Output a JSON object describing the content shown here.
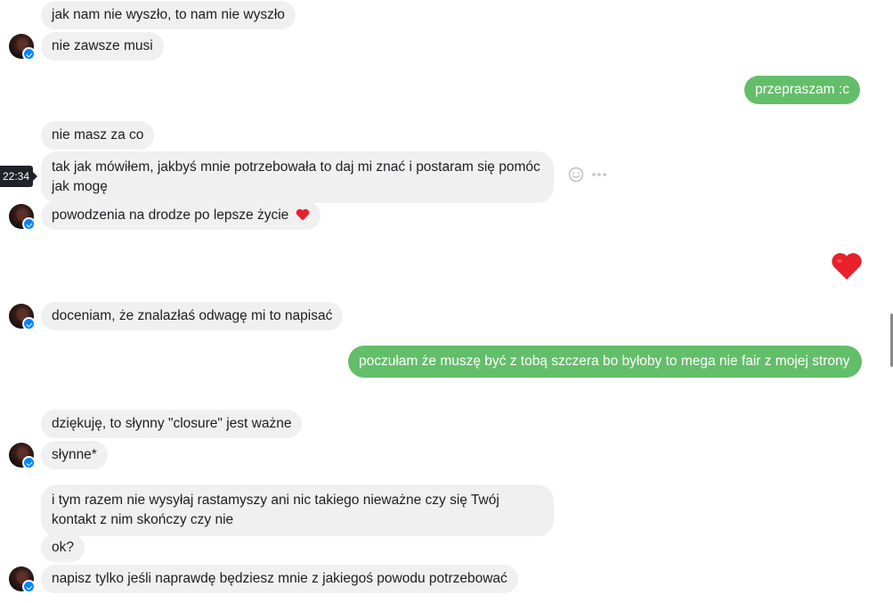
{
  "conversation": {
    "messages": [
      {
        "text": "jak nam nie wyszło, to nam nie wyszło",
        "side": "in"
      },
      {
        "text": "nie zawsze musi",
        "side": "in"
      },
      {
        "text": "przepraszam :c",
        "side": "out"
      },
      {
        "text": "nie masz za co",
        "side": "in"
      },
      {
        "text": "tak jak mówiłem, jakbyś mnie potrzebowała to daj mi znać i postaram się pomóc jak mogę",
        "side": "in"
      },
      {
        "text": "powodzenia na drodze po lepsze życie",
        "side": "in",
        "emoji": "heart"
      },
      {
        "emoji": "heart",
        "side": "out"
      },
      {
        "text": "doceniam, że znalazłaś odwagę mi to napisać",
        "side": "in"
      },
      {
        "text": "poczułam że muszę być z tobą szczera bo byłoby to mega nie fair z mojej strony",
        "side": "out"
      },
      {
        "text": "dziękuję, to słynny \"closure\" jest ważne",
        "side": "in"
      },
      {
        "text": "słynne*",
        "side": "in"
      },
      {
        "text": "i tym razem nie wysyłaj rastamyszy ani nic takiego nieważne czy się Twój kontakt z nim skończy czy nie",
        "side": "in"
      },
      {
        "text": "ok?",
        "side": "in"
      },
      {
        "text": "napisz tylko jeśli naprawdę będziesz mnie z jakiegoś powodu potrzebować",
        "side": "in"
      }
    ],
    "hover_timestamp": "22:34",
    "icons": {
      "react": "smiley-icon",
      "more": "more-dots-icon",
      "heart": "heart-icon",
      "badge": "messenger-badge-icon"
    },
    "colors": {
      "outgoing_bubble": "#63be6a",
      "incoming_bubble": "#f0f0f0",
      "heart": "#e8202c"
    }
  }
}
